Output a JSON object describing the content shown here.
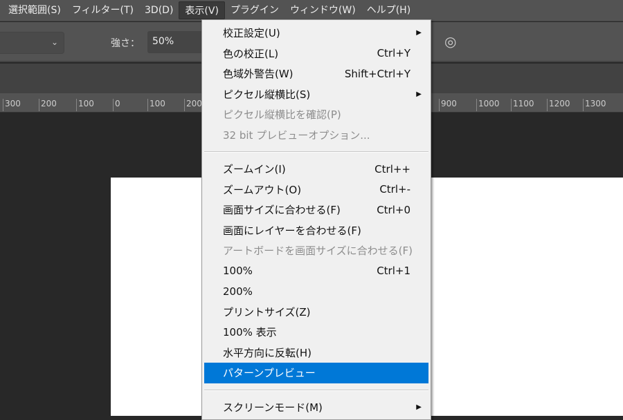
{
  "menubar": [
    {
      "label": "選択範囲(S)"
    },
    {
      "label": "フィルター(T)"
    },
    {
      "label": "3D(D)"
    },
    {
      "label": "表示(V)",
      "active": true
    },
    {
      "label": "プラグイン"
    },
    {
      "label": "ウィンドウ(W)"
    },
    {
      "label": "ヘルプ(H)"
    }
  ],
  "options": {
    "strength_label": "強さ：",
    "strength_value": "50%",
    "airbrush_icon": "airbrush-icon"
  },
  "ruler": [
    "300",
    "200",
    "100",
    "0",
    "100",
    "200",
    "900",
    "1000",
    "1100",
    "1200",
    "1300"
  ],
  "menu": [
    {
      "label": "校正設定(U)",
      "submenu": true
    },
    {
      "label": "色の校正(L)",
      "shortcut": "Ctrl+Y"
    },
    {
      "label": "色域外警告(W)",
      "shortcut": "Shift+Ctrl+Y"
    },
    {
      "label": "ピクセル縦横比(S)",
      "submenu": true
    },
    {
      "label": "ピクセル縦横比を確認(P)",
      "disabled": true
    },
    {
      "label": "32 bit プレビューオプション...",
      "disabled": true
    },
    {
      "separator": true
    },
    {
      "label": "ズームイン(I)",
      "shortcut": "Ctrl++"
    },
    {
      "label": "ズームアウト(O)",
      "shortcut": "Ctrl+-"
    },
    {
      "label": "画面サイズに合わせる(F)",
      "shortcut": "Ctrl+0"
    },
    {
      "label": "画面にレイヤーを合わせる(F)"
    },
    {
      "label": "アートボードを画面サイズに合わせる(F)",
      "disabled": true
    },
    {
      "label": "100%",
      "shortcut": "Ctrl+1"
    },
    {
      "label": "200%"
    },
    {
      "label": "プリントサイズ(Z)"
    },
    {
      "label": "100% 表示"
    },
    {
      "label": "水平方向に反転(H)"
    },
    {
      "label": "パターンプレビュー",
      "highlighted": true
    },
    {
      "separator": true
    },
    {
      "label": "スクリーンモード(M)",
      "submenu": true
    }
  ],
  "colors": {
    "highlight": "#0078d7",
    "menu_bg": "#f0f0f0",
    "ui_bg": "#535353",
    "canvas_bg": "#282828"
  }
}
